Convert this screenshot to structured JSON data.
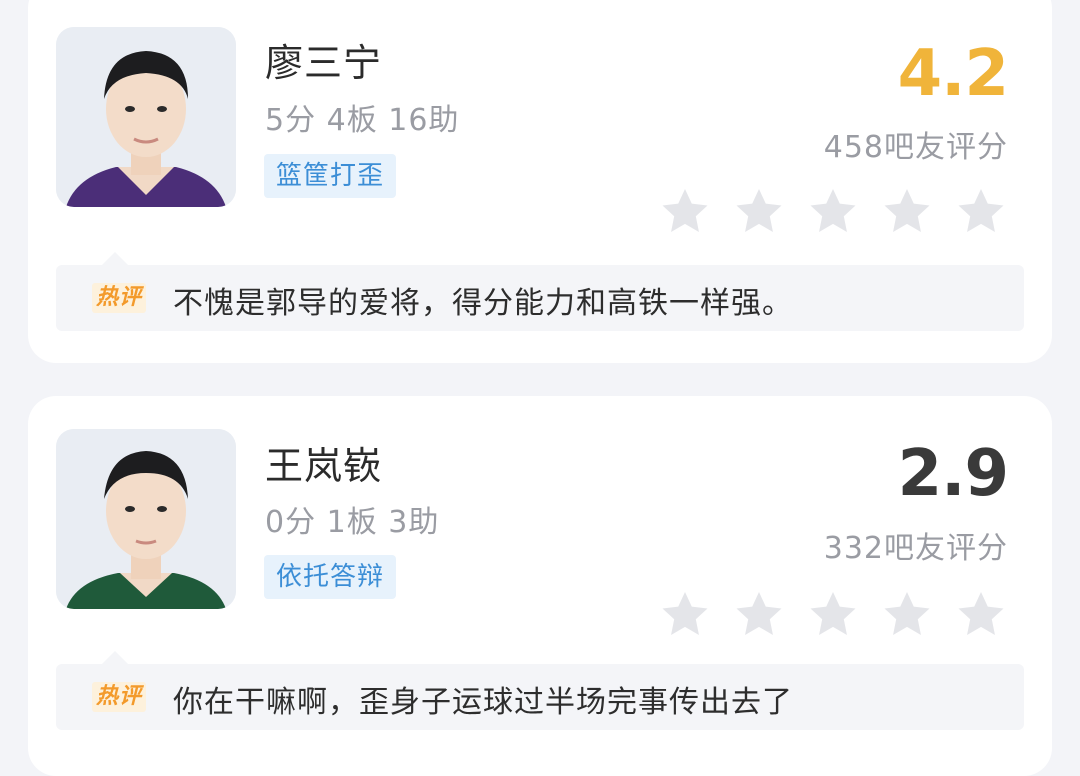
{
  "players": [
    {
      "name": "廖三宁",
      "stats": "5分 4板 16助",
      "tag": "篮筐打歪",
      "score": "4.2",
      "score_color": "#f0b43a",
      "rating_count": "458吧友评分",
      "stars_filled": 0,
      "hot_label": "热评",
      "comment": "不愧是郭导的爱将，得分能力和高铁一样强。",
      "jersey_color": "#4b2e78"
    },
    {
      "name": "王岚嵚",
      "stats": "0分 1板 3助",
      "tag": "依托答辩",
      "score": "2.9",
      "score_color": "#3a3a3a",
      "rating_count": "332吧友评分",
      "stars_filled": 0,
      "hot_label": "热评",
      "comment": "你在干嘛啊，歪身子运球过半场完事传出去了",
      "jersey_color": "#1f5a3a"
    }
  ],
  "star_icon": "star-icon",
  "colors": {
    "star_empty": "#e4e5e9",
    "tag_bg": "#e7f2fc",
    "tag_text": "#3c8ed6",
    "hot_text": "#f39a2b"
  }
}
